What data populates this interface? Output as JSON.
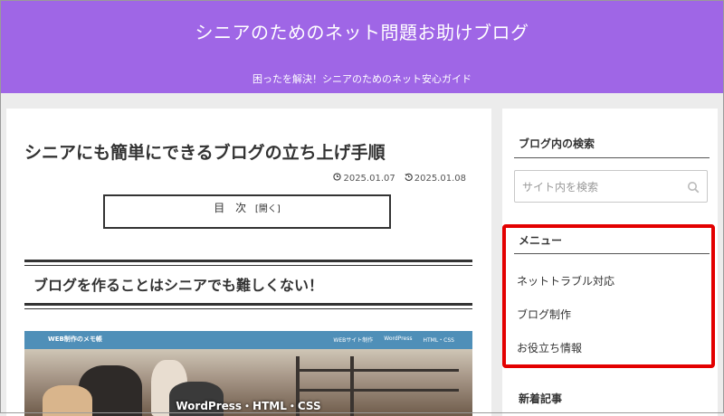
{
  "header": {
    "site_title": "シニアのためのネット問題お助けブログ",
    "tagline": "困ったを解決！シニアのためのネット安心ガイド",
    "bg_color": "#9f66e6"
  },
  "post": {
    "title": "シニアにも簡単にできるブログの立ち上げ手順",
    "published_icon": "clock-icon",
    "published": "2025.01.07",
    "updated_icon": "history-icon",
    "updated": "2025.01.08",
    "toc_title": "目 次",
    "toc_toggle": "[開く]",
    "h2": "ブログを作ることはシニアでも難しくない！",
    "hero": {
      "bar_title": "WEB制作のメモ帳",
      "nav": [
        "WEBサイト制作",
        "WordPress",
        "HTML・CSS"
      ],
      "caption": "WordPress・HTML・CSS"
    }
  },
  "sidebar": {
    "search_heading": "ブログ内の検索",
    "search_placeholder": "サイト内を検索",
    "menu_heading": "メニュー",
    "menu_items": [
      "ネットトラブル対応",
      "ブログ制作",
      "お役立ち情報"
    ],
    "recent_heading": "新着記事",
    "highlight_color": "#e30000"
  }
}
